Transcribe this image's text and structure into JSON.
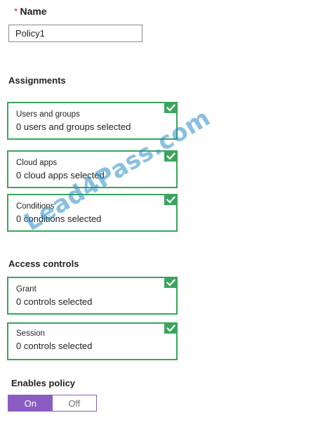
{
  "name_section": {
    "required_marker": "*",
    "label": "Name",
    "value": "Policy1"
  },
  "assignments": {
    "heading": "Assignments",
    "cards": [
      {
        "title": "Users and groups",
        "subtitle": "0 users and groups selected",
        "checked": true
      },
      {
        "title": "Cloud apps",
        "subtitle": "0 cloud apps selected",
        "checked": true
      },
      {
        "title": "Conditions",
        "subtitle": "0 conditions selected",
        "checked": true
      }
    ]
  },
  "access_controls": {
    "heading": "Access controls",
    "cards": [
      {
        "title": "Grant",
        "subtitle": "0 controls selected",
        "checked": true
      },
      {
        "title": "Session",
        "subtitle": "0 controls selected",
        "checked": true
      }
    ]
  },
  "enable_policy": {
    "label": "Enables policy",
    "options": [
      "On",
      "Off"
    ],
    "selected": "On"
  },
  "watermark": {
    "text": "Lead4Pass.com"
  },
  "colors": {
    "card_border": "#3aa55c",
    "toggle_on": "#8b5cc4",
    "required": "#d9302f"
  }
}
